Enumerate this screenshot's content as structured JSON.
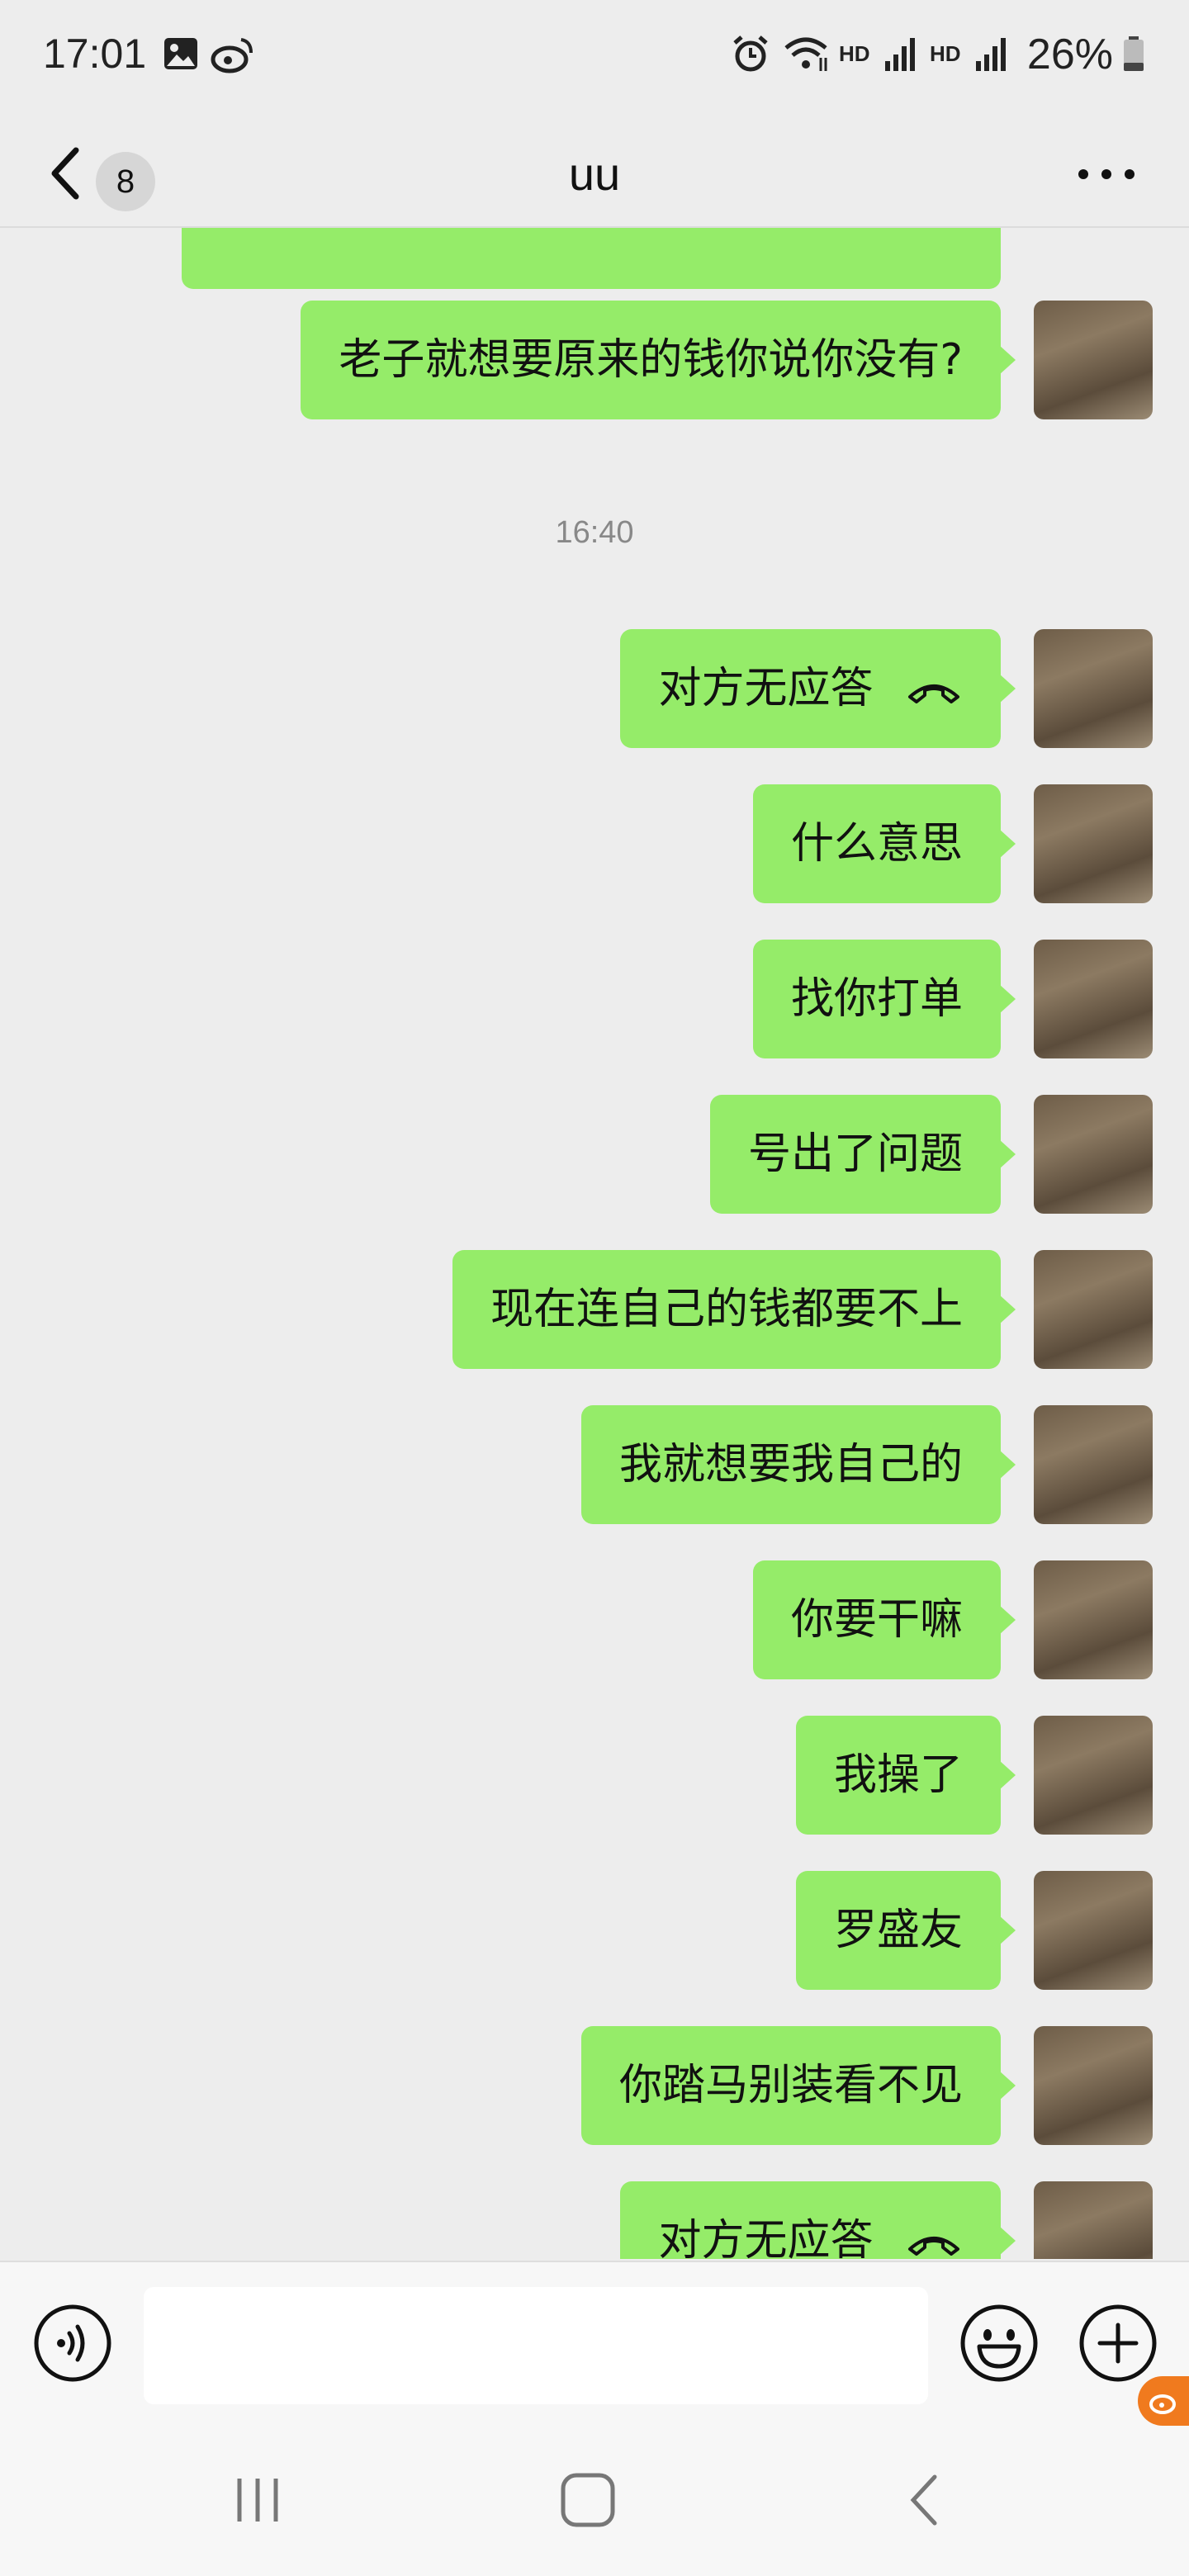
{
  "status_bar": {
    "time": "17:01",
    "hd1": "HD",
    "hd2": "HD",
    "battery": "26%"
  },
  "header": {
    "unread_count": "8",
    "title": "uu"
  },
  "messages": [
    {
      "type": "text",
      "text": "老子就想要原来的钱你说你没有?"
    },
    {
      "type": "timestamp",
      "text": "16:40"
    },
    {
      "type": "call",
      "text": "对方无应答"
    },
    {
      "type": "text",
      "text": "什么意思"
    },
    {
      "type": "text",
      "text": "找你打单"
    },
    {
      "type": "text",
      "text": "号出了问题"
    },
    {
      "type": "text",
      "text": "现在连自己的钱都要不上"
    },
    {
      "type": "text",
      "text": "我就想要我自己的"
    },
    {
      "type": "text",
      "text": "你要干嘛"
    },
    {
      "type": "text",
      "text": "我操了"
    },
    {
      "type": "text",
      "text": "罗盛友"
    },
    {
      "type": "text",
      "text": "你踏马别装看不见"
    },
    {
      "type": "call",
      "text": "对方无应答"
    }
  ],
  "input": {
    "value": "",
    "placeholder": ""
  },
  "colors": {
    "bubble": "#95ec69",
    "background": "#ededed",
    "accent_tab": "#f07a1e"
  }
}
